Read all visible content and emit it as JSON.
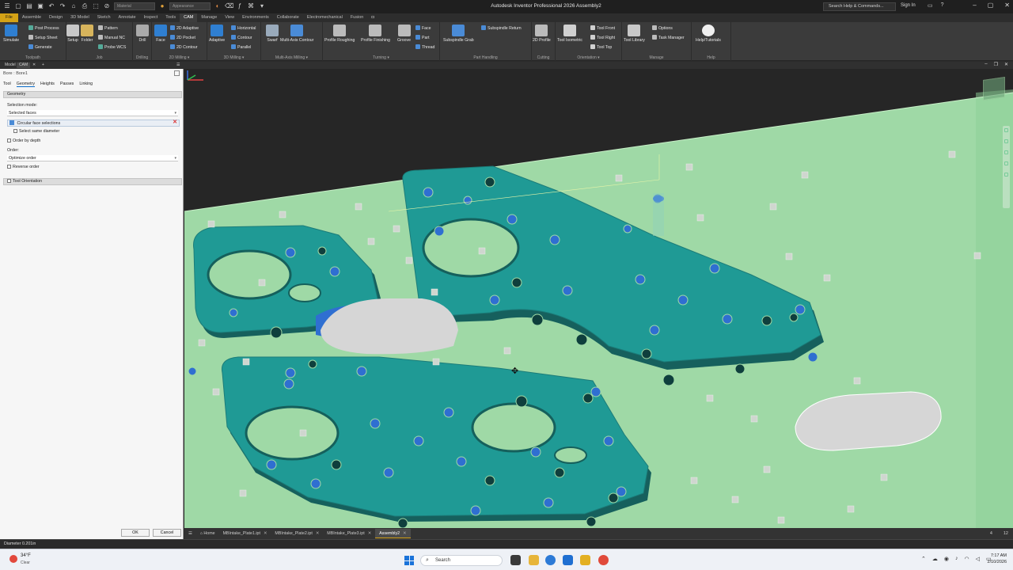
{
  "titlebar": {
    "app_title": "Autodesk Inventor Professional 2026   Assembly2",
    "material_combo": "Material",
    "appearance_combo": "Appearance",
    "search_placeholder": "Search Help & Commands...",
    "sign_in": "Sign In"
  },
  "tabs": [
    "File",
    "Assemble",
    "Design",
    "3D Model",
    "Sketch",
    "Annotate",
    "Inspect",
    "Tools",
    "CAM",
    "Manage",
    "View",
    "Environments",
    "Collaborate",
    "Electromechanical",
    "Fusion"
  ],
  "active_tab": "CAM",
  "ribbon": {
    "toolpath": {
      "label": "Toolpath",
      "simulate": "Simulate",
      "post_process": "Post Process",
      "setup_sheet": "Setup Sheet",
      "generate": "Generate"
    },
    "job": {
      "label": "Job",
      "setup": "Setup",
      "folder": "Folder",
      "pattern": "Pattern",
      "manual_nc": "Manual NC",
      "probe_wcs": "Probe WCS"
    },
    "drilling": {
      "label": "Drilling",
      "drill": "Drill"
    },
    "milling2d": {
      "label": "2D Milling",
      "face": "Face",
      "adaptive_2d": "2D Adaptive",
      "pocket_2d": "2D Pocket",
      "contour_2d": "2D Contour"
    },
    "milling3d": {
      "label": "3D Milling",
      "adaptive": "Adaptive",
      "horizontal": "Horizontal",
      "contour": "Contour",
      "parallel": "Parallel"
    },
    "multiaxis": {
      "label": "Multi-Axis Milling",
      "swarf": "Swarf",
      "multiaxis_contour": "Multi-Axis Contour"
    },
    "turning": {
      "label": "Turning",
      "profile_roughing": "Profile Roughing",
      "profile_finishing": "Profile Finishing",
      "groove": "Groove",
      "face": "Face",
      "part": "Part",
      "thread": "Thread"
    },
    "part_handling": {
      "label": "Part Handling",
      "subspindle_return": "Subspindle Return",
      "subspindle_grab": "Subspindle Grab"
    },
    "cutting": {
      "label": "Cutting",
      "profile_2d": "2D Profile"
    },
    "orientation": {
      "label": "Orientation",
      "tool_isometric": "Tool Isometric",
      "tool_front": "Tool Front",
      "tool_right": "Tool Right",
      "tool_top": "Tool Top"
    },
    "manage": {
      "label": "Manage",
      "tool_library": "Tool Library",
      "options": "Options",
      "task_manager": "Task Manager"
    },
    "help": {
      "label": "Help",
      "help_tutorials": "Help/Tutorials"
    }
  },
  "subtabs": [
    "Model",
    "CAM"
  ],
  "panel": {
    "title": "Bore : Bore1",
    "tabs": [
      "Tool",
      "Geometry",
      "Heights",
      "Passes",
      "Linking"
    ],
    "active_tab": "Geometry",
    "geometry_header": "Geometry",
    "selection_mode_label": "Selection mode:",
    "selection_mode_value": "Selected faces",
    "selection_item": "Circular face selections",
    "select_same_diameter": "Select same diameter",
    "order_by_depth": "Order by depth",
    "order_label": "Order:",
    "order_value": "Optimize order",
    "reverse_order": "Reverse order",
    "tool_orientation": "Tool Orientation",
    "ok": "OK",
    "cancel": "Cancel"
  },
  "doc_tabs": [
    "Home",
    "MBIntake_Plate1.ipt",
    "MBIntake_Plate2.ipt",
    "MBIntake_Plate3.ipt",
    "Assembly2"
  ],
  "active_doc_tab": "Assembly2",
  "page_indicator": {
    "left": "4",
    "right": "12"
  },
  "status_text": "Diameter 0.201in",
  "taskbar": {
    "weather_temp": "34°F",
    "weather_desc": "Clear",
    "search_label": "Search",
    "time": "7:17 AM",
    "date": "2/10/2026"
  },
  "colors": {
    "ribbon_bg": "#3b3b3b",
    "accent": "#d4a216",
    "part_teal": "#1f9a95",
    "stock_green": "#9fd9a6",
    "selected_blue": "#2f6fd1"
  }
}
